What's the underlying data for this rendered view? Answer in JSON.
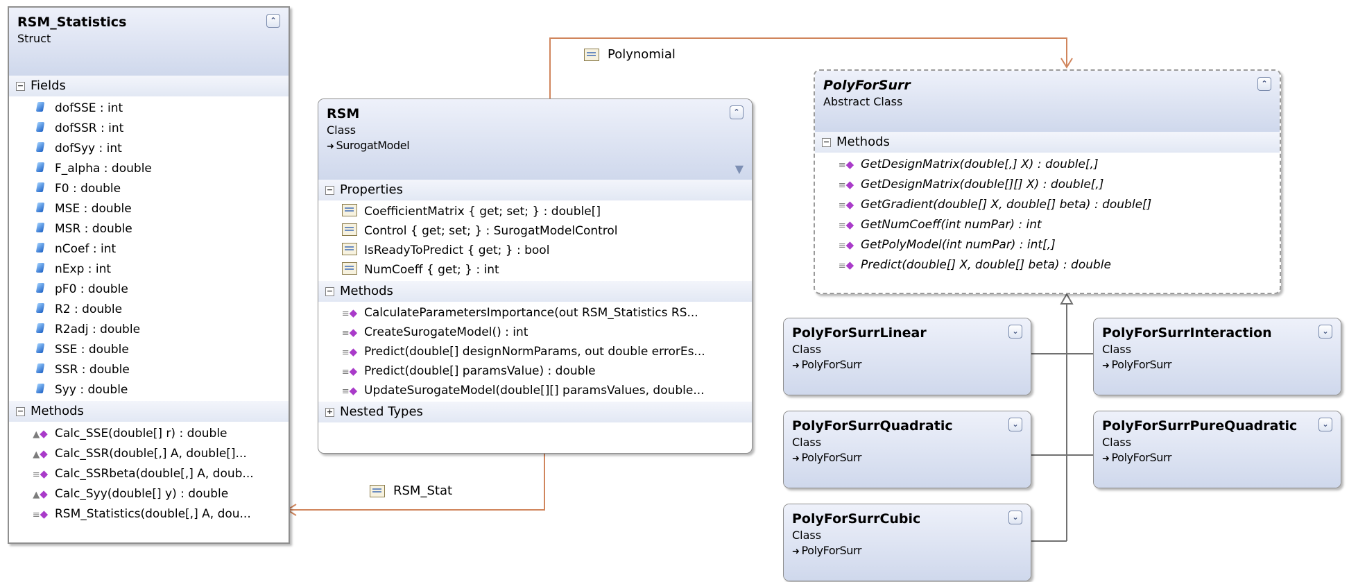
{
  "rsm_statistics": {
    "name": "RSM_Statistics",
    "kind": "Struct",
    "fields_header": "Fields",
    "fields": [
      "dofSSE : int",
      "dofSSR : int",
      "dofSyy : int",
      "F_alpha : double",
      "F0 : double",
      "MSE : double",
      "MSR : double",
      "nCoef : int",
      "nExp : int",
      "pF0 : double",
      "R2 : double",
      "R2adj : double",
      "SSE : double",
      "SSR : double",
      "Syy : double"
    ],
    "methods_header": "Methods",
    "methods": [
      "Calc_SSE(double[] r) : double",
      "Calc_SSR(double[,] A, double[]...",
      "Calc_SSRbeta(double[,] A, doub...",
      "Calc_Syy(double[] y) : double",
      "RSM_Statistics(double[,] A, dou..."
    ]
  },
  "rsm": {
    "name": "RSM",
    "kind": "Class",
    "base": "SurogatModel",
    "properties_header": "Properties",
    "properties": [
      "CoefficientMatrix { get; set; } : double[]",
      "Control { get; set; } : SurogatModelControl",
      "IsReadyToPredict { get; } : bool",
      "NumCoeff { get; } : int"
    ],
    "methods_header": "Methods",
    "methods": [
      "CalculateParametersImportance(out RSM_Statistics RS...",
      "CreateSurogateModel() : int",
      "Predict(double[] designNormParams, out double errorEs...",
      "Predict(double[] paramsValue) : double",
      "UpdateSurogateModel(double[][] paramsValues, double..."
    ],
    "nested_header": "Nested Types"
  },
  "polyforsurr": {
    "name": "PolyForSurr",
    "kind": "Abstract Class",
    "methods_header": "Methods",
    "methods": [
      "GetDesignMatrix(double[,] X) : double[,]",
      "GetDesignMatrix(double[][] X) : double[,]",
      "GetGradient(double[] X, double[] beta) : double[]",
      "GetNumCoeff(int numPar) : int",
      "GetPolyModel(int numPar) : int[,]",
      "Predict(double[] X, double[] beta) : double"
    ]
  },
  "subclasses": {
    "linear": {
      "name": "PolyForSurrLinear",
      "kind": "Class",
      "base": "PolyForSurr"
    },
    "interaction": {
      "name": "PolyForSurrInteraction",
      "kind": "Class",
      "base": "PolyForSurr"
    },
    "quadratic": {
      "name": "PolyForSurrQuadratic",
      "kind": "Class",
      "base": "PolyForSurr"
    },
    "purequadratic": {
      "name": "PolyForSurrPureQuadratic",
      "kind": "Class",
      "base": "PolyForSurr"
    },
    "cubic": {
      "name": "PolyForSurrCubic",
      "kind": "Class",
      "base": "PolyForSurr"
    }
  },
  "associations": {
    "polynomial": "Polynomial",
    "rsm_stat": "RSM_Stat"
  },
  "colors": {
    "association_line": "#d0855c",
    "inheritance_line": "#707070",
    "header_gradient_top": "#eef1fa",
    "header_gradient_bottom": "#cfd8ec"
  }
}
